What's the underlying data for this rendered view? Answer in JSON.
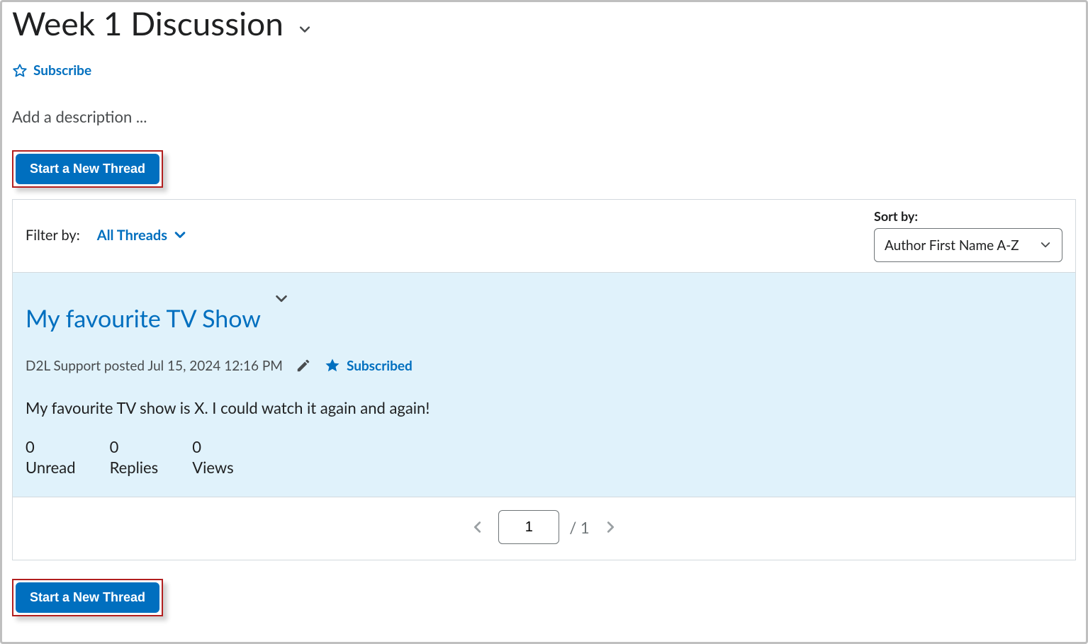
{
  "page": {
    "title": "Week 1 Discussion",
    "subscribe_label": "Subscribe",
    "description_placeholder": "Add a description ..."
  },
  "actions": {
    "new_thread_label": "Start a New Thread"
  },
  "filter": {
    "label": "Filter by:",
    "value": "All Threads"
  },
  "sort": {
    "label": "Sort by:",
    "selected": "Author First Name A-Z"
  },
  "thread": {
    "title": "My favourite TV Show",
    "author": "D2L Support",
    "posted_verb": "posted",
    "timestamp": "Jul 15, 2024 12:16 PM",
    "subscribed_label": "Subscribed",
    "body": "My favourite TV show is X. I could watch it again and again!",
    "stats": {
      "unread": {
        "count": "0",
        "label": "Unread"
      },
      "replies": {
        "count": "0",
        "label": "Replies"
      },
      "views": {
        "count": "0",
        "label": "Views"
      }
    }
  },
  "pager": {
    "current": "1",
    "total": "1"
  }
}
